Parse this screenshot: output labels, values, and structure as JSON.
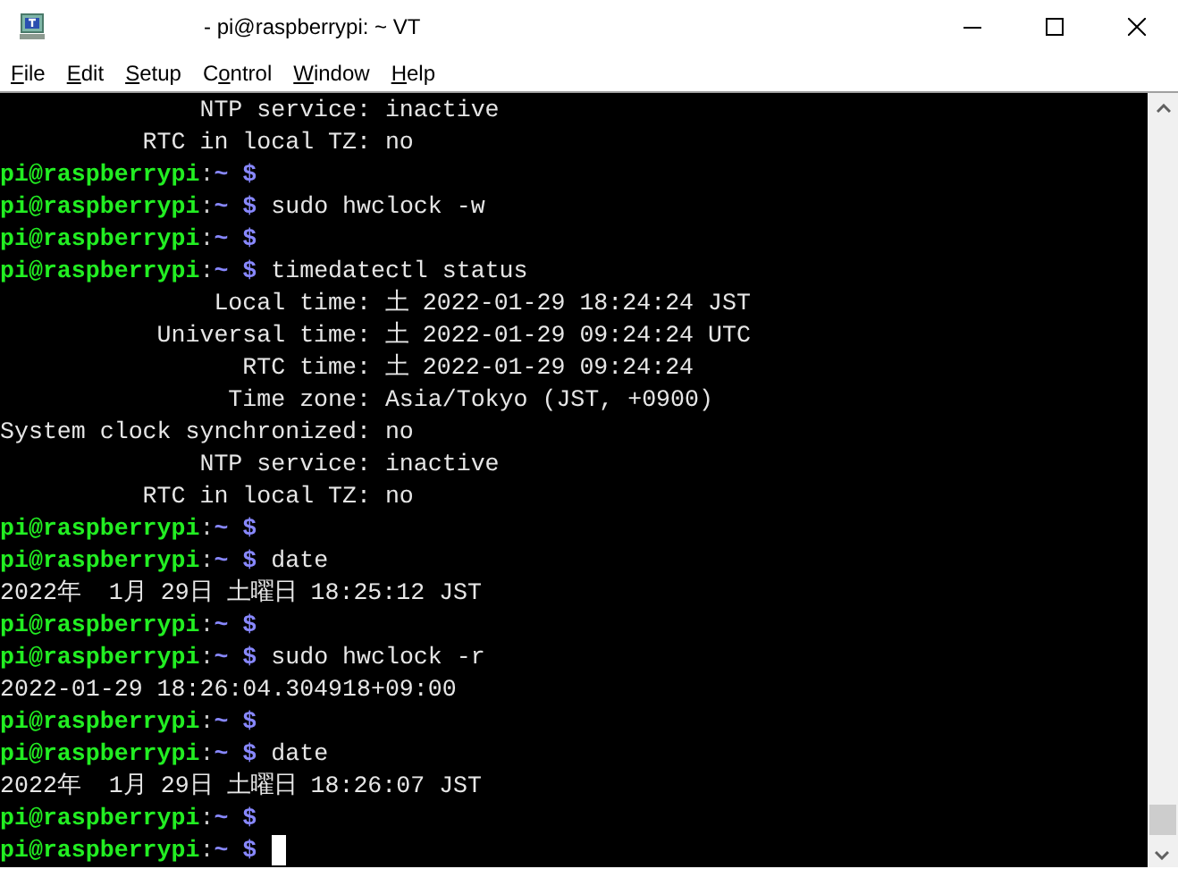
{
  "window": {
    "title": "- pi@raspberrypi: ~ VT"
  },
  "menu": [
    {
      "mnemonic": "F",
      "label_end": "ile"
    },
    {
      "mnemonic": "E",
      "label_end": "dit"
    },
    {
      "mnemonic": "S",
      "label_end": "etup"
    },
    {
      "label_start": "C",
      "mnemonic": "o",
      "label_end": "ntrol"
    },
    {
      "mnemonic": "W",
      "label_end": "indow"
    },
    {
      "mnemonic": "H",
      "label_end": "elp"
    }
  ],
  "terminal": {
    "lines": [
      {
        "kind": "output",
        "text": "              NTP service: inactive"
      },
      {
        "kind": "output",
        "text": "          RTC in local TZ: no"
      },
      {
        "kind": "prompt",
        "user_host": "pi@raspberrypi",
        "separator": ":",
        "path": "~",
        "symbol": "$"
      },
      {
        "kind": "prompt",
        "user_host": "pi@raspberrypi",
        "separator": ":",
        "path": "~",
        "symbol": "$",
        "command": "sudo hwclock -w"
      },
      {
        "kind": "prompt",
        "user_host": "pi@raspberrypi",
        "separator": ":",
        "path": "~",
        "symbol": "$"
      },
      {
        "kind": "prompt",
        "user_host": "pi@raspberrypi",
        "separator": ":",
        "path": "~",
        "symbol": "$",
        "command": "timedatectl status"
      },
      {
        "kind": "output",
        "text": "               Local time: 土 2022-01-29 18:24:24 JST"
      },
      {
        "kind": "output",
        "text": "           Universal time: 土 2022-01-29 09:24:24 UTC"
      },
      {
        "kind": "output",
        "text": "                 RTC time: 土 2022-01-29 09:24:24"
      },
      {
        "kind": "output",
        "text": "                Time zone: Asia/Tokyo (JST, +0900)"
      },
      {
        "kind": "output",
        "text": "System clock synchronized: no"
      },
      {
        "kind": "output",
        "text": "              NTP service: inactive"
      },
      {
        "kind": "output",
        "text": "          RTC in local TZ: no"
      },
      {
        "kind": "prompt",
        "user_host": "pi@raspberrypi",
        "separator": ":",
        "path": "~",
        "symbol": "$"
      },
      {
        "kind": "prompt",
        "user_host": "pi@raspberrypi",
        "separator": ":",
        "path": "~",
        "symbol": "$",
        "command": "date"
      },
      {
        "kind": "output",
        "text": "2022年  1月 29日 土曜日 18:25:12 JST"
      },
      {
        "kind": "prompt",
        "user_host": "pi@raspberrypi",
        "separator": ":",
        "path": "~",
        "symbol": "$"
      },
      {
        "kind": "prompt",
        "user_host": "pi@raspberrypi",
        "separator": ":",
        "path": "~",
        "symbol": "$",
        "command": "sudo hwclock -r"
      },
      {
        "kind": "output",
        "text": "2022-01-29 18:26:04.304918+09:00"
      },
      {
        "kind": "prompt",
        "user_host": "pi@raspberrypi",
        "separator": ":",
        "path": "~",
        "symbol": "$"
      },
      {
        "kind": "prompt",
        "user_host": "pi@raspberrypi",
        "separator": ":",
        "path": "~",
        "symbol": "$",
        "command": "date"
      },
      {
        "kind": "output",
        "text": "2022年  1月 29日 土曜日 18:26:07 JST"
      },
      {
        "kind": "prompt",
        "user_host": "pi@raspberrypi",
        "separator": ":",
        "path": "~",
        "symbol": "$"
      },
      {
        "kind": "prompt",
        "user_host": "pi@raspberrypi",
        "separator": ":",
        "path": "~",
        "symbol": "$",
        "cursor": true
      }
    ]
  }
}
